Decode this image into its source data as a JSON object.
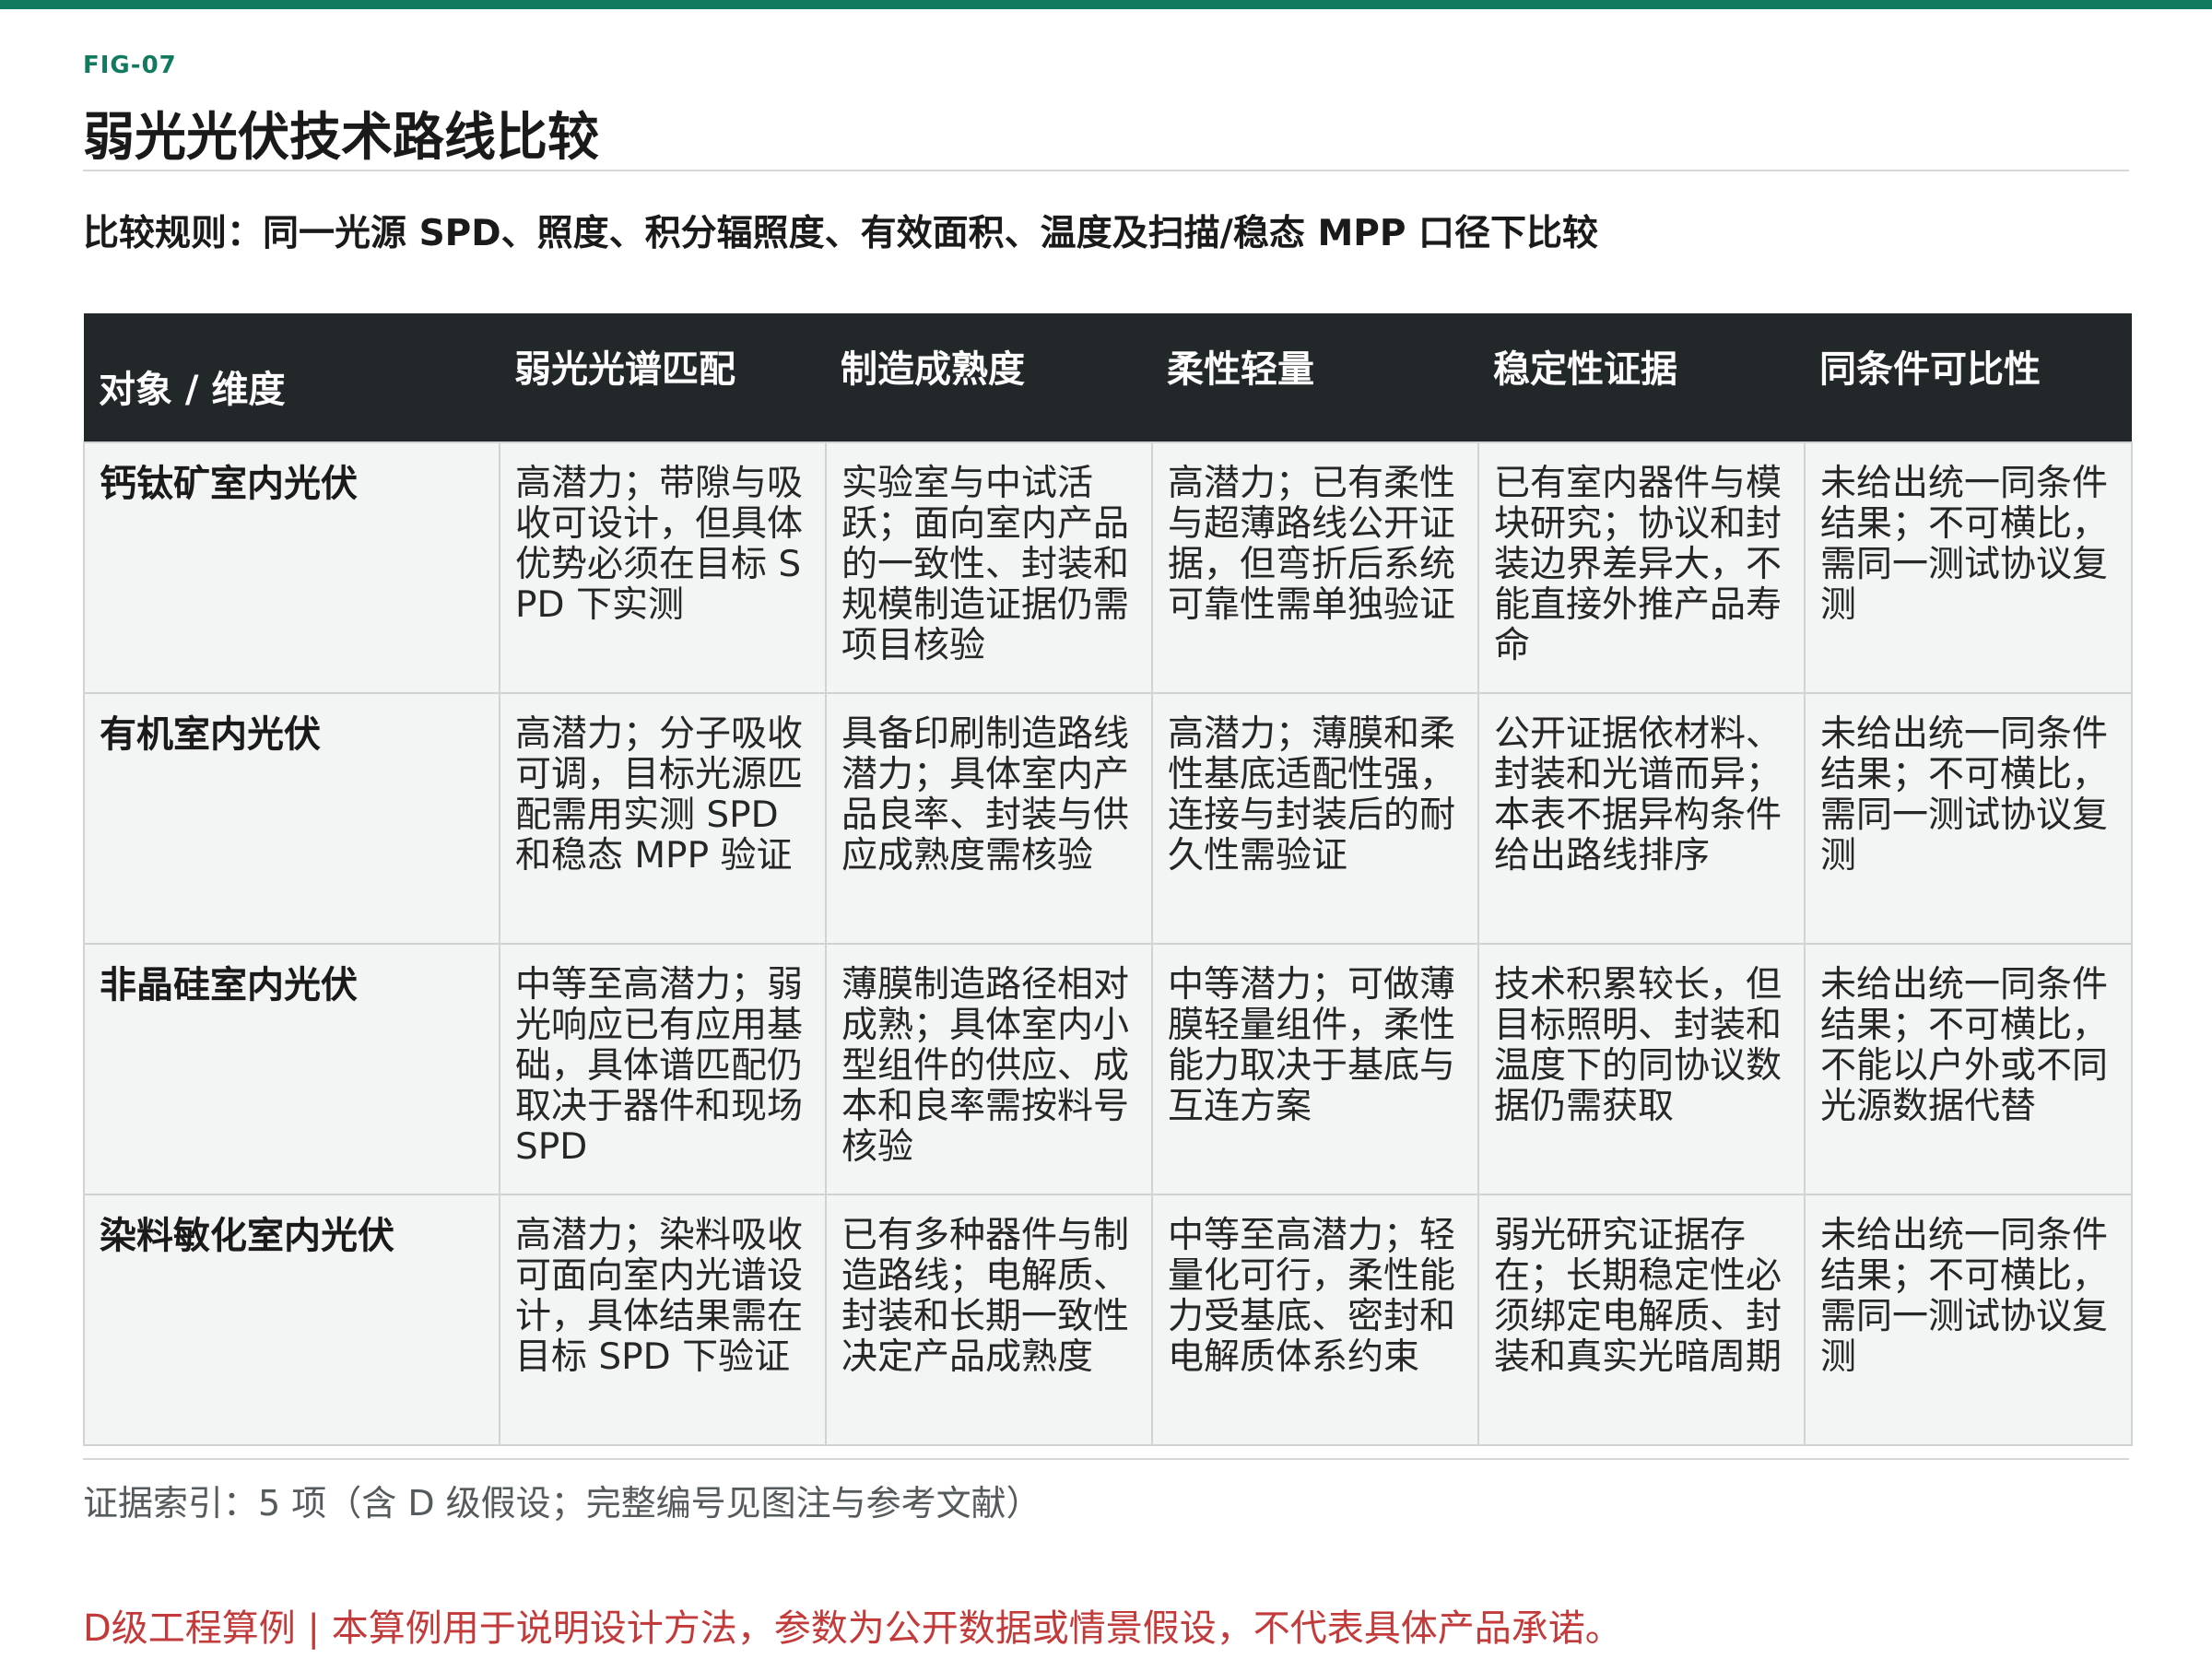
{
  "figure": {
    "label": "FIG-07",
    "title": "弱光光伏技术路线比较",
    "rule": "比较规则：同一光源 SPD、照度、积分辐照度、有效面积、温度及扫描/稳态 MPP 口径下比较"
  },
  "table": {
    "headers": [
      "对象 / 维度",
      "弱光光谱匹配",
      "制造成熟度",
      "柔性轻量",
      "稳定性证据",
      "同条件可比性"
    ],
    "rows": [
      {
        "object": "钙钛矿室内光伏",
        "cells": [
          "高潜力；带隙与吸收可设计，但具体优势必须在目标 SPD 下实测",
          "实验室与中试活跃；面向室内产品的一致性、封装和规模制造证据仍需项目核验",
          "高潜力；已有柔性与超薄路线公开证据，但弯折后系统可靠性需单独验证",
          "已有室内器件与模块研究；协议和封装边界差异大，不能直接外推产品寿命",
          "未给出统一同条件结果；不可横比，需同一测试协议复测"
        ]
      },
      {
        "object": "有机室内光伏",
        "cells": [
          "高潜力；分子吸收可调，目标光源匹配需用实测 SPD 和稳态 MPP 验证",
          "具备印刷制造路线潜力；具体室内产品良率、封装与供应成熟度需核验",
          "高潜力；薄膜和柔性基底适配性强，连接与封装后的耐久性需验证",
          "公开证据依材料、封装和光谱而异；本表不据异构条件给出路线排序",
          "未给出统一同条件结果；不可横比，需同一测试协议复测"
        ]
      },
      {
        "object": "非晶硅室内光伏",
        "cells": [
          "中等至高潜力；弱光响应已有应用基础，具体谱匹配仍取决于器件和现场 SPD",
          "薄膜制造路径相对成熟；具体室内小型组件的供应、成本和良率需按料号核验",
          "中等潜力；可做薄膜轻量组件，柔性能力取决于基底与互连方案",
          "技术积累较长，但目标照明、封装和温度下的同协议数据仍需获取",
          "未给出统一同条件结果；不可横比，不能以户外或不同光源数据代替"
        ]
      },
      {
        "object": "染料敏化室内光伏",
        "cells": [
          "高潜力；染料吸收可面向室内光谱设计，具体结果需在目标 SPD 下验证",
          "已有多种器件与制造路线；电解质、封装和长期一致性决定产品成熟度",
          "中等至高潜力；轻量化可行，柔性能力受基底、密封和电解质体系约束",
          "弱光研究证据存在；长期稳定性必须绑定电解质、封装和真实光暗周期",
          "未给出统一同条件结果；不可横比，需同一测试协议复测"
        ]
      }
    ]
  },
  "footer": {
    "evidence": "证据索引：5 项（含 D 级假设；完整编号见图注与参考文献）",
    "disclaimer": "D级工程算例 | 本算例用于说明设计方法，参数为公开数据或情景假设，不代表具体产品承诺。"
  },
  "colors": {
    "accent": "#127a5f",
    "header_bg": "#22272a",
    "cell_bg": "#f3f4f4",
    "disclaimer": "#c23a3a"
  }
}
